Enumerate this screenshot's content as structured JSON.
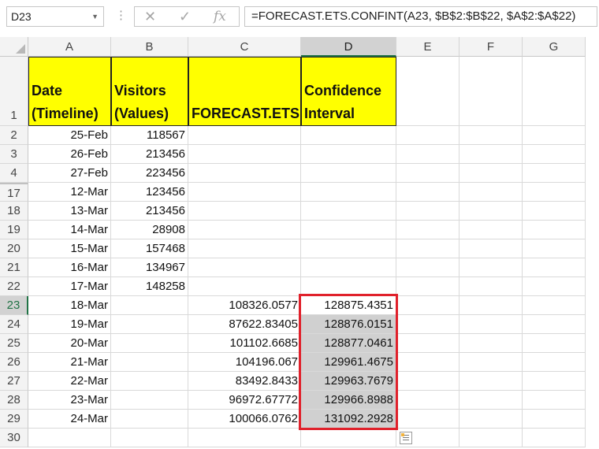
{
  "formula_bar": {
    "name_box": "D23",
    "cancel_icon": "✕",
    "enter_icon": "✓",
    "fx_label": "fx",
    "formula": "=FORECAST.ETS.CONFINT(A23, $B$2:$B$22, $A$2:$A$22)"
  },
  "columns": [
    "A",
    "B",
    "C",
    "D",
    "E",
    "F",
    "G"
  ],
  "selected_cell": "D23",
  "header_row": {
    "row_number": "1",
    "a": "Date (Timeline)",
    "b": "Visitors (Values)",
    "c": "FORECAST.ETS",
    "d": "Confidence Interval"
  },
  "rows": [
    {
      "n": "2",
      "a": "25-Feb",
      "b": "118567",
      "c": "",
      "d": ""
    },
    {
      "n": "3",
      "a": "26-Feb",
      "b": "213456",
      "c": "",
      "d": ""
    },
    {
      "n": "4",
      "a": "27-Feb",
      "b": "223456",
      "c": "",
      "d": ""
    },
    {
      "n": "17",
      "a": "12-Mar",
      "b": "123456",
      "c": "",
      "d": ""
    },
    {
      "n": "18",
      "a": "13-Mar",
      "b": "213456",
      "c": "",
      "d": ""
    },
    {
      "n": "19",
      "a": "14-Mar",
      "b": "28908",
      "c": "",
      "d": ""
    },
    {
      "n": "20",
      "a": "15-Mar",
      "b": "157468",
      "c": "",
      "d": ""
    },
    {
      "n": "21",
      "a": "16-Mar",
      "b": "134967",
      "c": "",
      "d": ""
    },
    {
      "n": "22",
      "a": "17-Mar",
      "b": "148258",
      "c": "",
      "d": ""
    },
    {
      "n": "23",
      "a": "18-Mar",
      "b": "",
      "c": "108326.0577",
      "d": "128875.4351"
    },
    {
      "n": "24",
      "a": "19-Mar",
      "b": "",
      "c": "87622.83405",
      "d": "128876.0151"
    },
    {
      "n": "25",
      "a": "20-Mar",
      "b": "",
      "c": "101102.6685",
      "d": "128877.0461"
    },
    {
      "n": "26",
      "a": "21-Mar",
      "b": "",
      "c": "104196.067",
      "d": "129961.4675"
    },
    {
      "n": "27",
      "a": "22-Mar",
      "b": "",
      "c": "83492.8433",
      "d": "129963.7679"
    },
    {
      "n": "28",
      "a": "23-Mar",
      "b": "",
      "c": "96972.67772",
      "d": "129966.8988"
    },
    {
      "n": "29",
      "a": "24-Mar",
      "b": "",
      "c": "100066.0762",
      "d": "131092.2928"
    },
    {
      "n": "30",
      "a": "",
      "b": "",
      "c": "",
      "d": ""
    }
  ],
  "colors": {
    "header_fill": "#ffff00",
    "selection_outline": "#e0212b",
    "range_fill": "#d0d0d0",
    "excel_green": "#217346"
  }
}
